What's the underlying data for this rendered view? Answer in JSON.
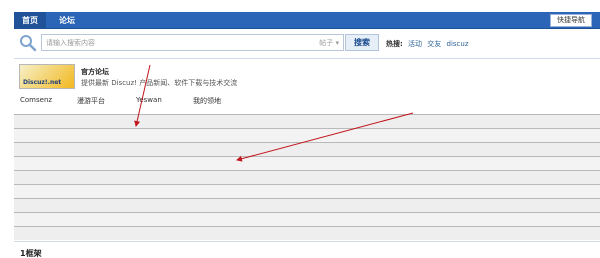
{
  "nav": {
    "tabs": [
      {
        "label": "首页"
      },
      {
        "label": "论坛"
      }
    ],
    "quick_nav_label": "快捷导航"
  },
  "search": {
    "placeholder": "请输入搜索内容",
    "type_label": "帖子 ▾",
    "button_label": "搜索",
    "hot_title": "热搜:",
    "hot_words": [
      "活动",
      "交友",
      "discuz"
    ]
  },
  "forum": {
    "logo_text": "Discuz!.net",
    "title": "官方论坛",
    "description": "提供最新 Discuz! 产品新闻、软件下载与技术交流"
  },
  "links": [
    "Comsenz",
    "漫游平台",
    "Yeswan",
    "我的领地"
  ],
  "section_title": "1框架",
  "colors": {
    "nav_bar": "#2b65b7",
    "arrow": "#c0151b"
  }
}
